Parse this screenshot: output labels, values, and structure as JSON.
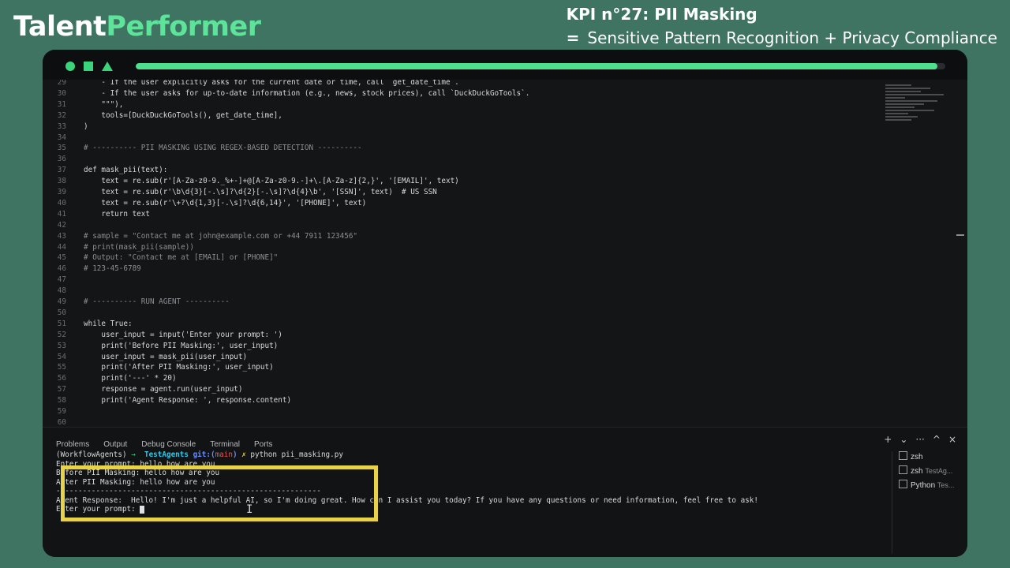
{
  "brand": {
    "part1": "Talent",
    "part2": "Performer"
  },
  "kpi": {
    "title": "KPI n°27: PII Masking",
    "eq": "=",
    "subtitle": "Sensitive Pattern Recognition + Privacy Compliance"
  },
  "progress": 0.99,
  "code": [
    {
      "n": "29",
      "t": "    - If the user explicitly asks for the current date or time, call `get_date_time`."
    },
    {
      "n": "30",
      "t": "    - If the user asks for up-to-date information (e.g., news, stock prices), call `DuckDuckGoTools`."
    },
    {
      "n": "31",
      "t": "    \"\"\"),"
    },
    {
      "n": "32",
      "t": "    tools=[DuckDuckGoTools(), get_date_time],"
    },
    {
      "n": "33",
      "t": ")"
    },
    {
      "n": "34",
      "t": ""
    },
    {
      "n": "35",
      "t": "# ---------- PII MASKING USING REGEX-BASED DETECTION ----------",
      "c": true
    },
    {
      "n": "36",
      "t": ""
    },
    {
      "n": "37",
      "t": "def mask_pii(text):"
    },
    {
      "n": "38",
      "t": "    text = re.sub(r'[A-Za-z0-9._%+-]+@[A-Za-z0-9.-]+\\.[A-Za-z]{2,}', '[EMAIL]', text)"
    },
    {
      "n": "39",
      "t": "    text = re.sub(r'\\b\\d{3}[-.\\s]?\\d{2}[-.\\s]?\\d{4}\\b', '[SSN]', text)  # US SSN"
    },
    {
      "n": "40",
      "t": "    text = re.sub(r'\\+?\\d{1,3}[-.\\s]?\\d{6,14}', '[PHONE]', text)"
    },
    {
      "n": "41",
      "t": "    return text"
    },
    {
      "n": "42",
      "t": ""
    },
    {
      "n": "43",
      "t": "# sample = \"Contact me at john@example.com or +44 7911 123456\"",
      "c": true
    },
    {
      "n": "44",
      "t": "# print(mask_pii(sample))",
      "c": true
    },
    {
      "n": "45",
      "t": "# Output: \"Contact me at [EMAIL] or [PHONE]\"",
      "c": true
    },
    {
      "n": "46",
      "t": "# 123-45-6789",
      "c": true
    },
    {
      "n": "47",
      "t": ""
    },
    {
      "n": "48",
      "t": ""
    },
    {
      "n": "49",
      "t": "# ---------- RUN AGENT ----------",
      "c": true
    },
    {
      "n": "50",
      "t": ""
    },
    {
      "n": "51",
      "t": "while True:"
    },
    {
      "n": "52",
      "t": "    user_input = input('Enter your prompt: ')"
    },
    {
      "n": "53",
      "t": "    print('Before PII Masking:', user_input)"
    },
    {
      "n": "54",
      "t": "    user_input = mask_pii(user_input)"
    },
    {
      "n": "55",
      "t": "    print('After PII Masking:', user_input)"
    },
    {
      "n": "56",
      "t": "    print('---' * 20)"
    },
    {
      "n": "57",
      "t": "    response = agent.run(user_input)"
    },
    {
      "n": "58",
      "t": "    print('Agent Response: ', response.content)"
    },
    {
      "n": "59",
      "t": ""
    },
    {
      "n": "60",
      "t": ""
    }
  ],
  "panel": {
    "tabs": [
      "Problems",
      "Output",
      "Debug Console",
      "Terminal",
      "Ports"
    ],
    "actions": [
      "+",
      "⌄",
      "···",
      "^",
      "×"
    ]
  },
  "terminal": {
    "env": "(WorkflowAgents)",
    "arrow": "→",
    "dir": "TestAgents",
    "git": "git:(",
    "branch": "main",
    "git_close": ")",
    "x": "✗",
    "cmd": "python pii_masking.py",
    "lines": [
      "Enter your prompt: hello how are you",
      "Before PII Masking: hello how are you",
      "After PII Masking: hello how are you",
      "------------------------------------------------------------",
      "Agent Response:  Hello! I'm just a helpful AI, so I'm doing great. How can I assist you today? If you have any questions or need information, feel free to ask!",
      "Enter your prompt: "
    ]
  },
  "terminals": [
    {
      "name": "zsh",
      "sub": ""
    },
    {
      "name": "zsh",
      "sub": "TestAg..."
    },
    {
      "name": "Python",
      "sub": "Tes..."
    }
  ],
  "cursor_glyph": "I"
}
